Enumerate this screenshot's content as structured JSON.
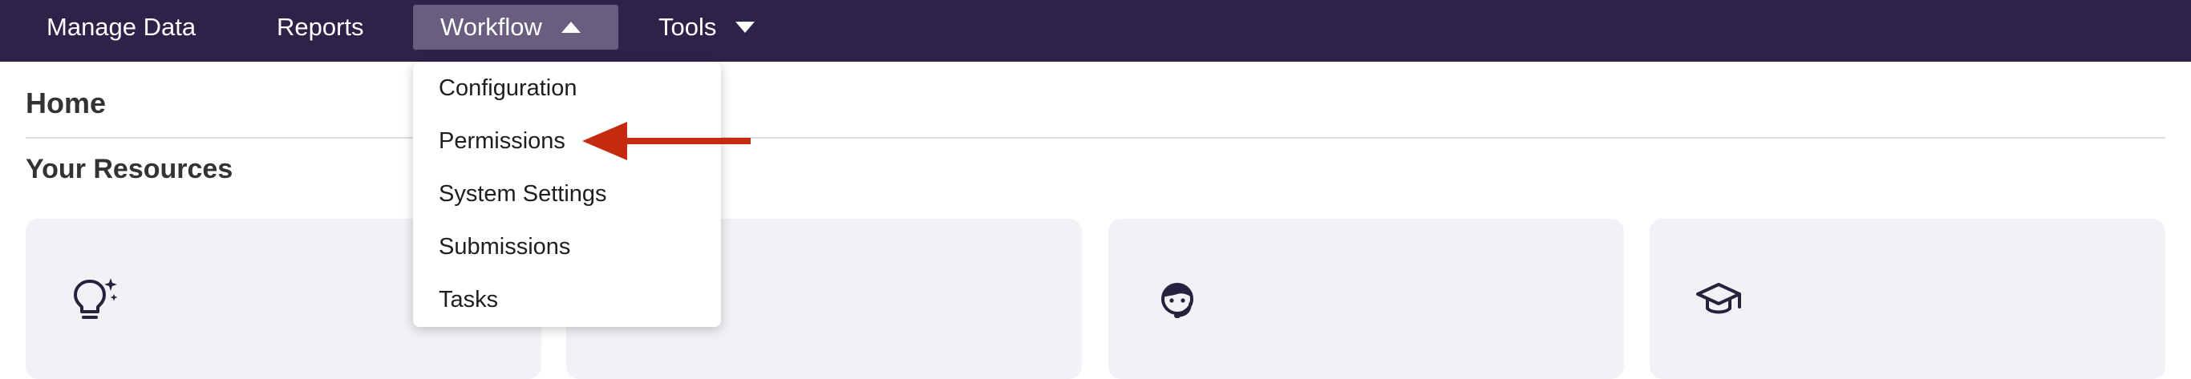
{
  "nav": {
    "items": [
      {
        "label": "Manage Data"
      },
      {
        "label": "Reports"
      },
      {
        "label": "Workflow"
      },
      {
        "label": "Tools"
      }
    ]
  },
  "page": {
    "title": "Home",
    "section_title": "Your Resources"
  },
  "dropdown": {
    "items": [
      {
        "label": "Configuration"
      },
      {
        "label": "Permissions"
      },
      {
        "label": "System Settings"
      },
      {
        "label": "Submissions"
      },
      {
        "label": "Tasks"
      }
    ]
  },
  "cards": [
    {
      "icon": "lightbulb-sparkle-icon"
    },
    {
      "icon": ""
    },
    {
      "icon": "support-agent-icon"
    },
    {
      "icon": "graduation-cap-icon"
    }
  ],
  "colors": {
    "navbar": "#2e2249",
    "nav_active": "#685e7f",
    "card_bg": "#f2f2f6",
    "annotation_arrow": "#c42a10"
  }
}
